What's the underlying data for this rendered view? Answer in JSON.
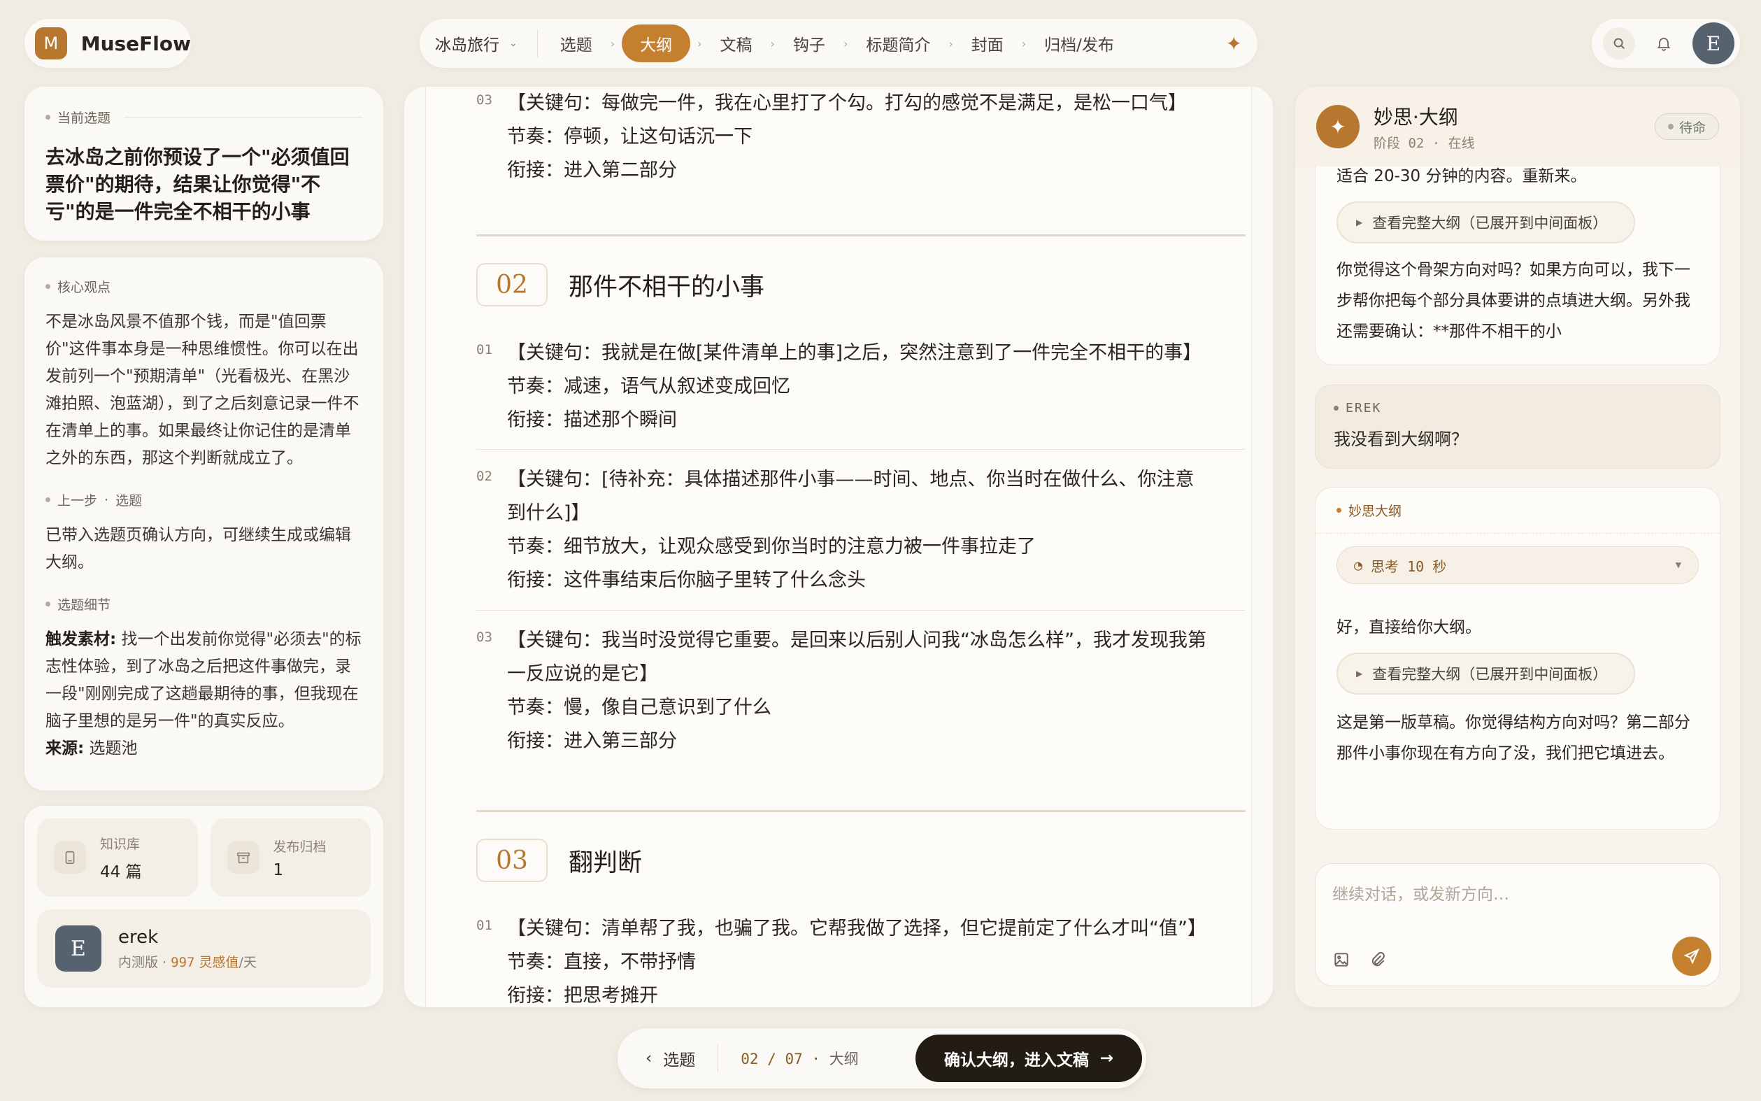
{
  "brand": {
    "logo_letter": "M",
    "name": "MuseFlow"
  },
  "stepper": {
    "project": "冰岛旅行",
    "steps": [
      "选题",
      "大纲",
      "文稿",
      "钩子",
      "标题简介",
      "封面",
      "归档/发布"
    ],
    "active_index": 1
  },
  "header_actions": {
    "avatar_letter": "E"
  },
  "left": {
    "topic_label": "当前选题",
    "topic_title": "去冰岛之前你预设了一个\"必须值回票价\"的期待，结果让你觉得\"不亏\"的是一件完全不相干的小事",
    "core_label": "核心观点",
    "core_text": "不是冰岛风景不值那个钱，而是\"值回票价\"这件事本身是一种思维惯性。你可以在出发前列一个\"预期清单\"（光看极光、在黑沙滩拍照、泡蓝湖），到了之后刻意记录一件不在清单上的事。如果最终让你记住的是清单之外的东西，那这个判断就成立了。",
    "prev_label": "上一步",
    "prev_value": "选题",
    "prev_text": "已带入选题页确认方向，可继续生成或编辑大纲。",
    "detail_label": "选题细节",
    "detail_key": "触发素材:",
    "detail_text": " 找一个出发前你觉得\"必须去\"的标志性体验，到了冰岛之后把这件事做完，录一段\"刚刚完成了这趟最期待的事，但我现在脑子里想的是另一件\"的真实反应。",
    "source_label": "来源:",
    "source_value": " 选题池",
    "stats": [
      {
        "label": "知识库",
        "value": "44 篇"
      },
      {
        "label": "发布归档",
        "value": "1"
      }
    ],
    "user": {
      "avatar_letter": "E",
      "name": "erek",
      "tier": "内测版",
      "points": "997",
      "points_label": "灵感值",
      "per": "/天"
    }
  },
  "outline": {
    "top_item": {
      "num": "03",
      "lines": [
        "【关键句：每做完一件，我在心里打了个勾。打勾的感觉不是满足，是松一口气】",
        "节奏：停顿，让这句话沉一下",
        "衔接：进入第二部分"
      ]
    },
    "sections": [
      {
        "num": "02",
        "title": "那件不相干的小事",
        "items": [
          {
            "num": "01",
            "lines": [
              "【关键句：我就是在做[某件清单上的事]之后，突然注意到了一件完全不相干的事】",
              "节奏：减速，语气从叙述变成回忆",
              "衔接：描述那个瞬间"
            ]
          },
          {
            "num": "02",
            "lines": [
              "【关键句：[待补充：具体描述那件小事——时间、地点、你当时在做什么、你注意",
              "到什么]】",
              "节奏：细节放大，让观众感受到你当时的注意力被一件事拉走了",
              "衔接：这件事结束后你脑子里转了什么念头"
            ]
          },
          {
            "num": "03",
            "lines": [
              "【关键句：我当时没觉得它重要。是回来以后别人问我“冰岛怎么样”，我才发现我第",
              "一反应说的是它】",
              "节奏：慢，像自己意识到了什么",
              "衔接：进入第三部分"
            ]
          }
        ]
      },
      {
        "num": "03",
        "title": "翻判断",
        "items": [
          {
            "num": "01",
            "lines": [
              "【关键句：清单帮了我，也骗了我。它帮我做了选择，但它提前定了什么才叫“值”】",
              "节奏：直接，不带抒情",
              "衔接：把思考摊开"
            ]
          }
        ]
      }
    ]
  },
  "bottom_nav": {
    "back_label": "选题",
    "page_current": "02",
    "page_total": "07",
    "page_label": "大纲",
    "confirm_label": "确认大纲，进入文稿"
  },
  "assistant": {
    "avatar_glyph": "✦",
    "name": "妙思·大纲",
    "stage": "阶段 02 · 在线",
    "status": "待命",
    "msg1_top": "适合 20-30 分钟的内容。重新来。",
    "view_outline_label": "查看完整大纲（已展开到中间面板）",
    "msg1_body": "你觉得这个骨架方向对吗？如果方向可以，我下一步帮你把每个部分具体要讲的点填进大纲。另外我还需要确认：**那件不相干的小",
    "user_name": "EREK",
    "user_text": "我没看到大纲啊？",
    "ai_label": "妙思大纲",
    "think_label": "思考 10 秒",
    "reply1": "好，直接给你大纲。",
    "view_outline_label2": "查看完整大纲（已展开到中间面板）",
    "reply2": "这是第一版草稿。你觉得结构方向对吗？第二部分那件小事你现在有方向了没，我们把它填进去。",
    "input_placeholder": "继续对话，或发新方向…"
  }
}
